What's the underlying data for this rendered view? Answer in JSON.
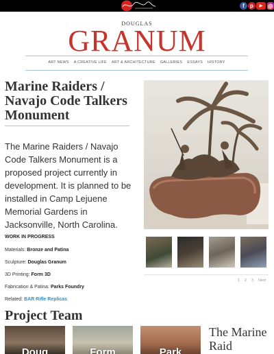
{
  "header": {
    "logo_alt": "signature-logo",
    "social": [
      {
        "name": "facebook-icon",
        "glyph": "f"
      },
      {
        "name": "pinterest-icon",
        "glyph": "p"
      },
      {
        "name": "youtube-icon",
        "glyph": "▶"
      },
      {
        "name": "instagram-icon",
        "glyph": "◎"
      }
    ]
  },
  "brand": {
    "small": "DOUGLAS",
    "big": "GRANUM",
    "accent": "#c8342c"
  },
  "nav": {
    "items": [
      "ART NEWS",
      "A CREATIVE LIFE",
      "ART & ARCHITECTURE",
      "GALLERIES",
      "ESSAYS",
      "HISTORY"
    ]
  },
  "page": {
    "title": "Marine Raiders / Navajo Code Talkers Monument",
    "lead": "The Marine Raiders / Navajo Code Talkers Monument is a proposed project currently in development. It is planned to be installed in Camp Lejuene Memorial Gardens in Jacksonville, North Carolina.",
    "status": "WORK IN PROGRESS",
    "meta": [
      {
        "label": "Materials: ",
        "value": "Bronze and Patina"
      },
      {
        "label": "Sculpture: ",
        "value": "Douglas Granum"
      },
      {
        "label": "3D Printing:  ",
        "value": "Form 3D"
      },
      {
        "label": "Fabrication & Patina: ",
        "value": "Parks Foundry"
      }
    ],
    "related_label": "Related: ",
    "related_link": "BAR Rifle Replicas"
  },
  "gallery": {
    "pager": [
      "1",
      "2",
      "3",
      "Next"
    ]
  },
  "team": {
    "heading": "Project Team",
    "cards": [
      "Doug",
      "Form",
      "Park"
    ],
    "side_title": "The Marine Raid"
  }
}
